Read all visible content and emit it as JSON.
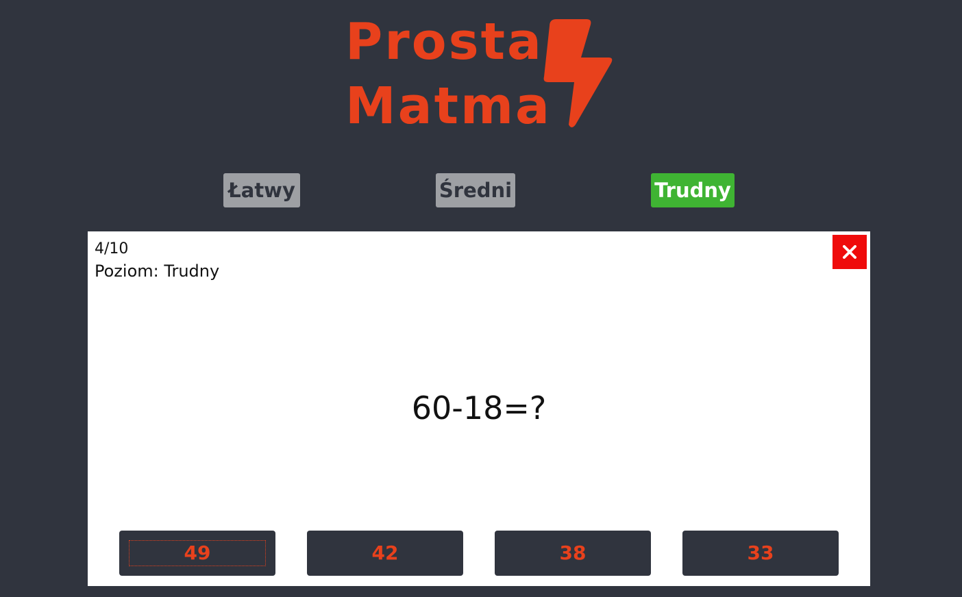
{
  "logo": {
    "line1": "Prosta",
    "line2": "Matma",
    "icon": "lightning-bolt-icon",
    "color": "#e8411c"
  },
  "levels": [
    {
      "label": "Łatwy",
      "active": false
    },
    {
      "label": "Średni",
      "active": false
    },
    {
      "label": "Trudny",
      "active": true
    }
  ],
  "quiz": {
    "progress": "4/10",
    "level_text": "Poziom: Trudny",
    "question": "60-18=?",
    "close_icon": "close-icon",
    "answers": [
      "49",
      "42",
      "38",
      "33"
    ]
  },
  "colors": {
    "background": "#30343e",
    "accent": "#e8411c",
    "active_level": "#3fb433",
    "inactive_level": "#9ea0a4",
    "close": "#ef0b0b"
  }
}
